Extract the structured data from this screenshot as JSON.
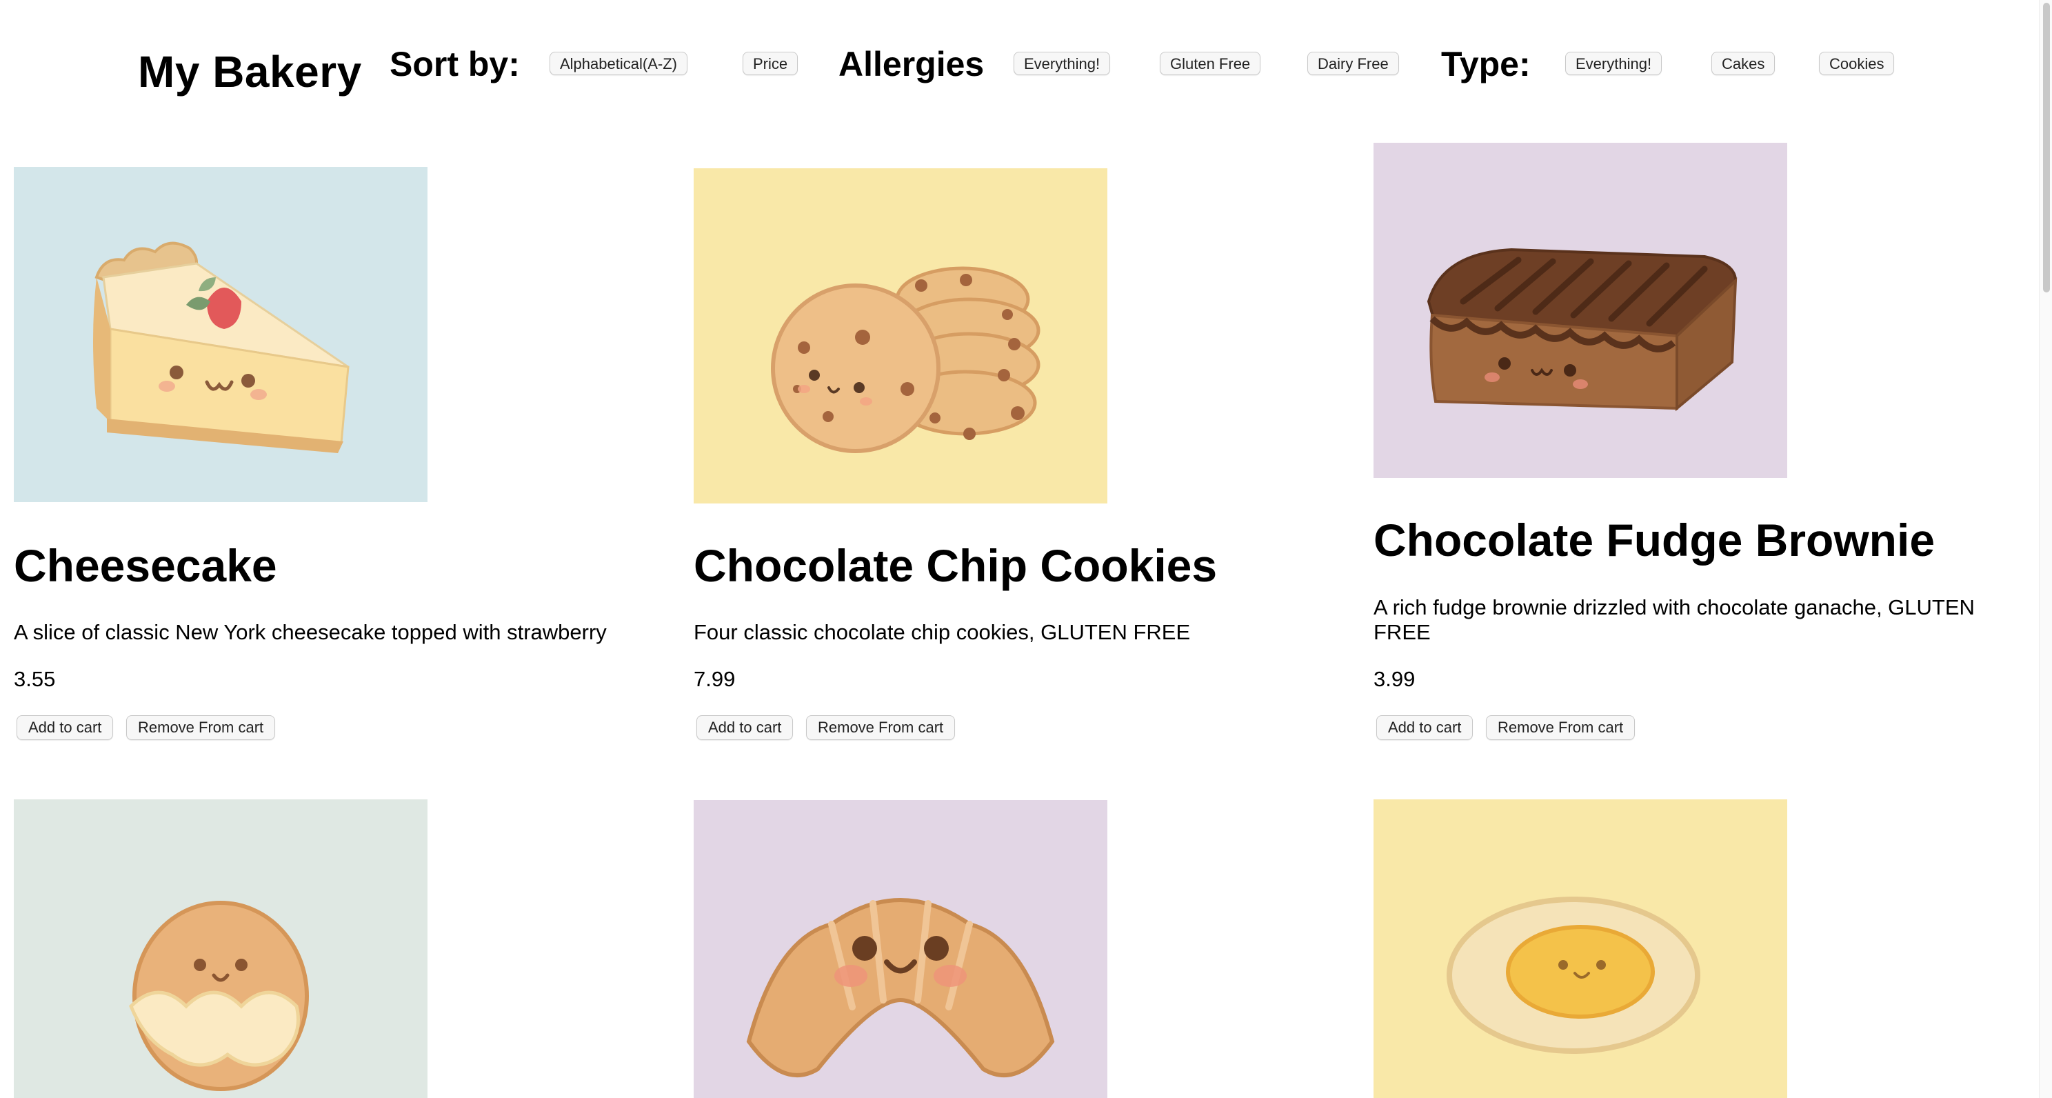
{
  "header": {
    "brand": "My Bakery",
    "sort": {
      "label": "Sort by:",
      "options": [
        "Alphabetical(A-Z)",
        "Price"
      ]
    },
    "allergies": {
      "label": "Allergies",
      "options": [
        "Everything!",
        "Gluten Free",
        "Dairy Free"
      ]
    },
    "type": {
      "label": "Type:",
      "options": [
        "Everything!",
        "Cakes",
        "Cookies"
      ]
    }
  },
  "products": [
    {
      "name": "Cheesecake",
      "description": "A slice of classic New York cheesecake topped with strawberry",
      "price": "3.55",
      "add_label": "Add to cart",
      "remove_label": "Remove From cart",
      "image_bg": "#d3e6ea",
      "icon": "cheesecake-illustration"
    },
    {
      "name": "Chocolate Chip Cookies",
      "description": "Four classic chocolate chip cookies, GLUTEN FREE",
      "price": "7.99",
      "add_label": "Add to cart",
      "remove_label": "Remove From cart",
      "image_bg": "#f9e8a8",
      "icon": "cookies-illustration"
    },
    {
      "name": "Chocolate Fudge Brownie",
      "description": "A rich fudge brownie drizzled with chocolate ganache, GLUTEN FREE",
      "price": "3.99",
      "add_label": "Add to cart",
      "remove_label": "Remove From cart",
      "image_bg": "#e2d6e5",
      "icon": "brownie-illustration"
    },
    {
      "image_bg": "#dfe8e3",
      "icon": "cream-puff-illustration"
    },
    {
      "image_bg": "#e2d6e5",
      "icon": "croissant-illustration"
    },
    {
      "image_bg": "#f9e8a8",
      "icon": "egg-tart-illustration"
    }
  ]
}
